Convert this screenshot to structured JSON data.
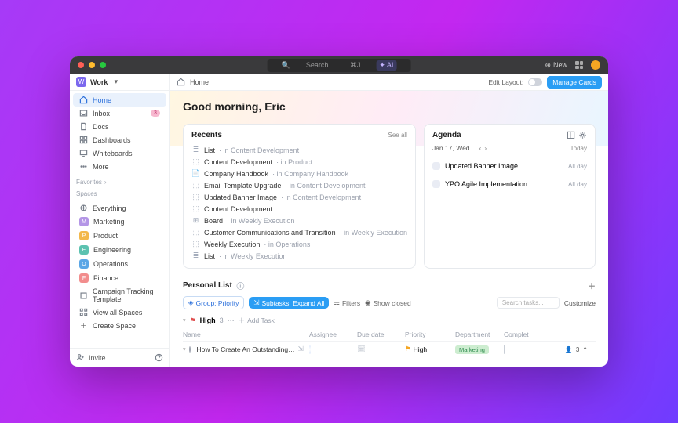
{
  "titlebar": {
    "search_placeholder": "Search...",
    "shortcut": "⌘J",
    "ai_label": "AI",
    "new_label": "New"
  },
  "workspace": {
    "initial": "W",
    "name": "Work"
  },
  "nav": {
    "home": "Home",
    "inbox": "Inbox",
    "inbox_count": "3",
    "docs": "Docs",
    "dashboards": "Dashboards",
    "whiteboards": "Whiteboards",
    "more": "More"
  },
  "sections": {
    "favorites": "Favorites",
    "spaces": "Spaces"
  },
  "spaces": {
    "everything": "Everything",
    "marketing": "Marketing",
    "m_i": "M",
    "product": "Product",
    "p_i": "P",
    "engineering": "Engineering",
    "e_i": "E",
    "operations": "Operations",
    "o_i": "O",
    "finance": "Finance",
    "f_i": "F",
    "campaign": "Campaign Tracking Template",
    "view_all": "View all Spaces",
    "create": "Create Space"
  },
  "sidebar_footer": {
    "invite": "Invite"
  },
  "topbar": {
    "home": "Home",
    "edit_layout": "Edit Layout:",
    "manage": "Manage Cards"
  },
  "greeting": "Good morning, Eric",
  "recents": {
    "title": "Recents",
    "see_all": "See all",
    "items": [
      {
        "name": "List",
        "meta": "· in Content Development"
      },
      {
        "name": "Content Development",
        "meta": "· in Product"
      },
      {
        "name": "Company Handbook",
        "meta": "· in Company Handbook"
      },
      {
        "name": "Email Template Upgrade",
        "meta": "· in Content Development"
      },
      {
        "name": "Updated Banner Image",
        "meta": "· in Content Development"
      },
      {
        "name": "Content Development",
        "meta": ""
      },
      {
        "name": "Board",
        "meta": "· in Weekly Execution"
      },
      {
        "name": "Customer Communications and Transition",
        "meta": "· in Weekly Execution"
      },
      {
        "name": "Weekly Execution",
        "meta": "· in Operations"
      },
      {
        "name": "List",
        "meta": "· in Weekly Execution"
      }
    ]
  },
  "agenda": {
    "title": "Agenda",
    "date": "Jan 17, Wed",
    "today": "Today",
    "items": [
      {
        "name": "Updated Banner Image",
        "when": "All day"
      },
      {
        "name": "YPO Agile Implementation",
        "when": "All day"
      }
    ]
  },
  "personal_list": {
    "title": "Personal List",
    "group_pill": "Group: Priority",
    "subtasks_pill": "Subtasks: Expand All",
    "filters": "Filters",
    "show_closed": "Show closed",
    "search_placeholder": "Search tasks...",
    "customize": "Customize",
    "group_name": "High",
    "group_count": "3",
    "add_task": "Add Task",
    "headers": {
      "name": "Name",
      "assignee": "Assignee",
      "due": "Due date",
      "priority": "Priority",
      "dept": "Department",
      "complete": "Complet"
    },
    "task": {
      "name": "How To Create An Outstanding…",
      "priority": "High",
      "dept": "Marketing"
    },
    "footer_count": "3"
  }
}
